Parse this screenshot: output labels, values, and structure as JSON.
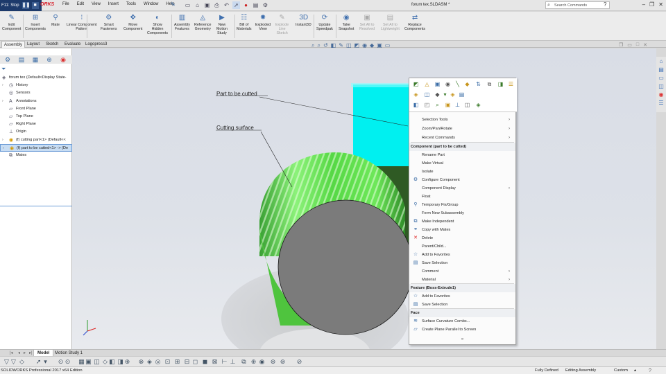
{
  "titlebar": {
    "stop_label": "F11: Stop",
    "pause_symbol": "❚❚",
    "stop_symbol": "■",
    "logo_text": "ORKS",
    "menus": [
      "File",
      "Edit",
      "View",
      "Insert",
      "Tools",
      "Window",
      "Help"
    ],
    "document_title": "forum tex.SLDASM *",
    "search_placeholder": "Search Commands"
  },
  "commands": [
    {
      "label": "Edit\nComponent",
      "icon": "edit-component-icon",
      "dim": false
    },
    {
      "label": "Insert\nComponents",
      "icon": "insert-components-icon",
      "dim": false
    },
    {
      "label": "Mate",
      "icon": "mate-icon",
      "dim": false
    },
    {
      "label": "Linear Component\nPattern",
      "icon": "linear-pattern-icon",
      "dim": false
    },
    {
      "label": "Smart\nFasteners",
      "icon": "smart-fasteners-icon",
      "dim": false
    },
    {
      "label": "Move\nComponent",
      "icon": "move-component-icon",
      "dim": false
    },
    {
      "label": "Show\nHidden\nComponents",
      "icon": "show-hidden-icon",
      "dim": false
    },
    {
      "label": "Assembly\nFeatures",
      "icon": "assembly-features-icon",
      "dim": false
    },
    {
      "label": "Reference\nGeometry",
      "icon": "reference-geometry-icon",
      "dim": false
    },
    {
      "label": "New\nMotion\nStudy",
      "icon": "motion-study-icon",
      "dim": false
    },
    {
      "label": "Bill of\nMaterials",
      "icon": "bom-icon",
      "dim": false
    },
    {
      "label": "Exploded\nView",
      "icon": "exploded-view-icon",
      "dim": false
    },
    {
      "label": "Explode\nLine\nSketch",
      "icon": "explode-line-icon",
      "dim": true
    },
    {
      "label": "Instant3D",
      "icon": "instant3d-icon",
      "dim": false
    },
    {
      "label": "Update\nSpeedpak",
      "icon": "speedpak-icon",
      "dim": false
    },
    {
      "label": "Take\nSnapshot",
      "icon": "snapshot-icon",
      "dim": false
    },
    {
      "label": "Set All to\nResolved",
      "icon": "resolved-icon",
      "dim": true
    },
    {
      "label": "Set All to\nLightweight",
      "icon": "lightweight-icon",
      "dim": true
    },
    {
      "label": "Replace\nComponents",
      "icon": "replace-components-icon",
      "dim": false
    }
  ],
  "tabs": [
    "Assembly",
    "Layout",
    "Sketch",
    "Evaluate",
    "Logopress3"
  ],
  "feature_tree": {
    "items": [
      {
        "label": "forum tex  (Default<Display State-",
        "icon": "assembly-icon",
        "indent": 0,
        "expander": ""
      },
      {
        "label": "History",
        "icon": "history-icon",
        "indent": 1,
        "expander": "›"
      },
      {
        "label": "Sensors",
        "icon": "sensors-icon",
        "indent": 1,
        "expander": ""
      },
      {
        "label": "Annotations",
        "icon": "annotations-icon",
        "indent": 1,
        "expander": "›"
      },
      {
        "label": "Front Plane",
        "icon": "plane-icon",
        "indent": 1,
        "expander": ""
      },
      {
        "label": "Top Plane",
        "icon": "plane-icon",
        "indent": 1,
        "expander": ""
      },
      {
        "label": "Right Plane",
        "icon": "plane-icon",
        "indent": 1,
        "expander": ""
      },
      {
        "label": "Origin",
        "icon": "origin-icon",
        "indent": 1,
        "expander": ""
      },
      {
        "label": "(f) cutting part<1> (Default<<",
        "icon": "part-icon",
        "indent": 1,
        "expander": "›"
      },
      {
        "label": "(f) part to be cutted<1> -> (De",
        "icon": "part-icon",
        "indent": 1,
        "expander": "›"
      },
      {
        "label": "Mates",
        "icon": "mates-icon",
        "indent": 1,
        "expander": ""
      }
    ]
  },
  "annotations": {
    "part_label": "Part to be cutted",
    "surface_label": "Cutting surface"
  },
  "context_menu": {
    "entries": [
      {
        "kind": "item",
        "label": "Selection Tools",
        "submenu": true,
        "icon": ""
      },
      {
        "kind": "item",
        "label": "Zoom/Pan/Rotate",
        "submenu": true,
        "icon": ""
      },
      {
        "kind": "item",
        "label": "Recent Commands",
        "submenu": true,
        "icon": ""
      },
      {
        "kind": "header",
        "label": "Component (part to be cutted)"
      },
      {
        "kind": "item",
        "label": "Rename Part",
        "submenu": false,
        "icon": ""
      },
      {
        "kind": "item",
        "label": "Make Virtual",
        "submenu": false,
        "icon": ""
      },
      {
        "kind": "item",
        "label": "Isolate",
        "submenu": false,
        "icon": ""
      },
      {
        "kind": "item",
        "label": "Configure Component",
        "submenu": false,
        "icon": "configure-icon"
      },
      {
        "kind": "item",
        "label": "Component Display",
        "submenu": true,
        "icon": ""
      },
      {
        "kind": "item",
        "label": "Float",
        "submenu": false,
        "icon": ""
      },
      {
        "kind": "item",
        "label": "Temporary Fix/Group",
        "submenu": false,
        "icon": "temporary-fix-icon"
      },
      {
        "kind": "item",
        "label": "Form New Subassembly",
        "submenu": false,
        "icon": ""
      },
      {
        "kind": "item",
        "label": "Make Independent",
        "submenu": false,
        "icon": "make-independent-icon"
      },
      {
        "kind": "item",
        "label": "Copy with Mates",
        "submenu": false,
        "icon": "copy-mates-icon"
      },
      {
        "kind": "item",
        "label": "Delete",
        "submenu": false,
        "icon": "delete-icon"
      },
      {
        "kind": "item",
        "label": "Parent/Child...",
        "submenu": false,
        "icon": ""
      },
      {
        "kind": "item",
        "label": "Add to Favorites",
        "submenu": false,
        "icon": "favorites-icon"
      },
      {
        "kind": "item",
        "label": "Save Selection",
        "submenu": false,
        "icon": "save-selection-icon"
      },
      {
        "kind": "item",
        "label": "Comment",
        "submenu": true,
        "icon": ""
      },
      {
        "kind": "item",
        "label": "Material",
        "submenu": true,
        "icon": ""
      },
      {
        "kind": "header",
        "label": "Feature (Boss-Extrude1)"
      },
      {
        "kind": "item",
        "label": "Add to Favorites",
        "submenu": false,
        "icon": "favorites-icon"
      },
      {
        "kind": "item",
        "label": "Save Selection",
        "submenu": false,
        "icon": "save-selection-icon"
      },
      {
        "kind": "header",
        "label": "Face"
      },
      {
        "kind": "item",
        "label": "Surface Curvature Combs...",
        "submenu": false,
        "icon": "curvature-icon"
      },
      {
        "kind": "item",
        "label": "Create Plane Parallel to Screen",
        "submenu": false,
        "icon": "plane-parallel-icon"
      }
    ],
    "more_symbol": "»"
  },
  "bottom_tabs": [
    "Model",
    "Motion Study 1"
  ],
  "status": {
    "edition": "SOLIDWORKS Professional 2017 x64 Edition",
    "definition": "Fully Defined",
    "mode": "Editing Assembly",
    "units": "Custom"
  },
  "colors": {
    "cyan_part": "#00f5f5",
    "dark_green_face": "#2f5a24",
    "cylinder_green": "#5fdc4a",
    "cylinder_end": "#7a7a7a"
  }
}
